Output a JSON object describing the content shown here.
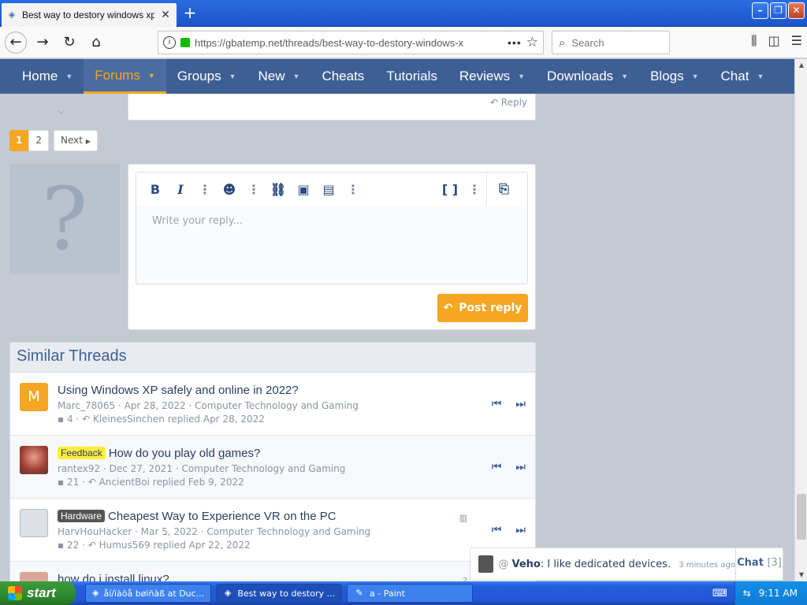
{
  "browser": {
    "tab_title": "Best way to destory windows xp",
    "new_tab": "+",
    "tab_close": "✕",
    "url": "https://gbatemp.net/threads/best-way-to-destory-windows-x",
    "search_placeholder": "Search",
    "window_buttons": {
      "minimize": "–",
      "maximize": "❐",
      "close": "✕"
    }
  },
  "nav": {
    "items": [
      {
        "label": "Home",
        "caret": true
      },
      {
        "label": "Forums",
        "caret": true,
        "active": true
      },
      {
        "label": "Groups",
        "caret": true
      },
      {
        "label": "New",
        "caret": true
      },
      {
        "label": "Cheats",
        "caret": false
      },
      {
        "label": "Tutorials",
        "caret": false
      },
      {
        "label": "Reviews",
        "caret": true
      },
      {
        "label": "Downloads",
        "caret": true
      },
      {
        "label": "Blogs",
        "caret": true
      },
      {
        "label": "Chat",
        "caret": true
      }
    ]
  },
  "post": {
    "reply_label": "Reply"
  },
  "pagination": {
    "pages": [
      "1",
      "2"
    ],
    "current": "1",
    "next_label": "Next"
  },
  "editor": {
    "placeholder": "Write your reply...",
    "post_button": "Post reply"
  },
  "similar_threads": {
    "heading": "Similar Threads",
    "rows": [
      {
        "avatar_letter": "M",
        "avatar_color": "#f5a623",
        "prefix": "",
        "title": "Using Windows XP safely and online in 2022?",
        "author": "Marc_78065",
        "date": "Apr 28, 2022",
        "forum": "Computer Technology and Gaming",
        "replies": "4",
        "last_poster": "KleinesSinchen",
        "replied": "replied Apr 28, 2022"
      },
      {
        "avatar_letter": "",
        "avatar_color": "#b4534b",
        "prefix": "Feedback",
        "title": "How do you play old games?",
        "author": "rantex92",
        "date": "Dec 27, 2021",
        "forum": "Computer Technology and Gaming",
        "replies": "21",
        "last_poster": "AncientBoi",
        "replied": "replied Feb 9, 2022"
      },
      {
        "avatar_letter": "",
        "avatar_color": "#c9cdd3",
        "prefix": "Hardware",
        "title": "Cheapest Way to Experience VR on the PC",
        "author": "HarvHouHacker",
        "date": "Mar 5, 2022",
        "forum": "Computer Technology and Gaming",
        "replies": "22",
        "last_poster": "Humus569",
        "replied": "replied Apr 22, 2022"
      },
      {
        "avatar_letter": "",
        "avatar_color": "#d9a79a",
        "prefix": "",
        "title": "how do i install linux?",
        "author": "",
        "date": "",
        "forum": "",
        "replies": "",
        "last_poster": "",
        "replied": ""
      }
    ]
  },
  "chat": {
    "at": "@",
    "user": "Veho",
    "message": "I like dedicated devices.",
    "time": "3 minutes ago",
    "label": "Chat",
    "count": "[3]"
  },
  "taskbar": {
    "start": "start",
    "tasks": [
      {
        "label": "åí/ìàöå bøìñàß at Duc...",
        "active": false
      },
      {
        "label": "Best way to destory ...",
        "active": true
      },
      {
        "label": "a - Paint",
        "active": false
      }
    ],
    "clock": "9:11 AM"
  }
}
